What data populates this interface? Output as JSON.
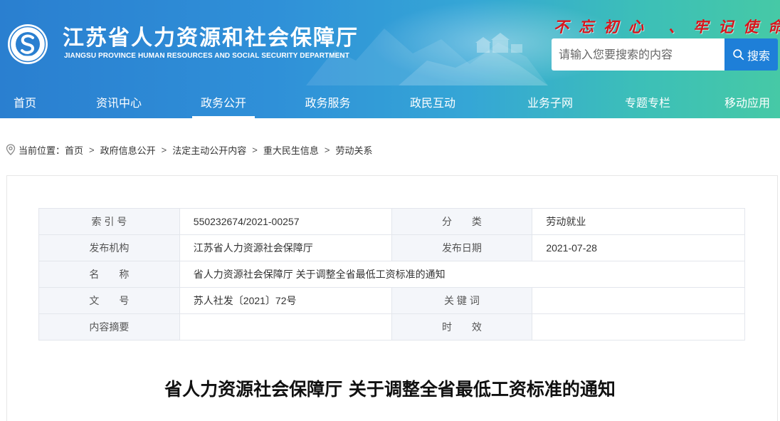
{
  "header": {
    "site_title": "江苏省人力资源和社会保障厅",
    "site_subtitle": "JIANGSU PROVINCE HUMAN RESOURCES AND SOCIAL SECURITY DEPARTMENT",
    "slogan": "不忘初心 、牢记使命",
    "search": {
      "placeholder": "请输入您要搜索的内容",
      "button_label": "搜索"
    },
    "colors": {
      "slogan": "#d9141b",
      "search_button": "#1e7fd8",
      "header_left": "#2a7fd0",
      "header_right": "#46c9a6"
    }
  },
  "nav": {
    "items": [
      "首页",
      "资讯中心",
      "政务公开",
      "政务服务",
      "政民互动",
      "业务子网",
      "专题专栏",
      "移动应用"
    ],
    "active": "政务公开"
  },
  "breadcrumb": {
    "prefix": "当前位置：",
    "items": [
      "首页",
      "政府信息公开",
      "法定主动公开内容",
      "重大民生信息",
      "劳动关系"
    ],
    "separator": ">"
  },
  "meta": {
    "index_label": "索 引 号",
    "index_value": "550232674/2021-00257",
    "category_label": "分　　类",
    "category_value": "劳动就业",
    "publisher_label": "发布机构",
    "publisher_value": "江苏省人力资源社会保障厅",
    "date_label": "发布日期",
    "date_value": "2021-07-28",
    "name_label": "名　　称",
    "name_value": "省人力资源社会保障厅 关于调整全省最低工资标准的通知",
    "docno_label": "文　　号",
    "docno_value": "苏人社发〔2021〕72号",
    "keywords_label": "关 键 词",
    "keywords_value": "",
    "summary_label": "内容摘要",
    "summary_value": "",
    "validity_label": "时　　效",
    "validity_value": ""
  },
  "document": {
    "title": "省人力资源社会保障厅 关于调整全省最低工资标准的通知"
  }
}
